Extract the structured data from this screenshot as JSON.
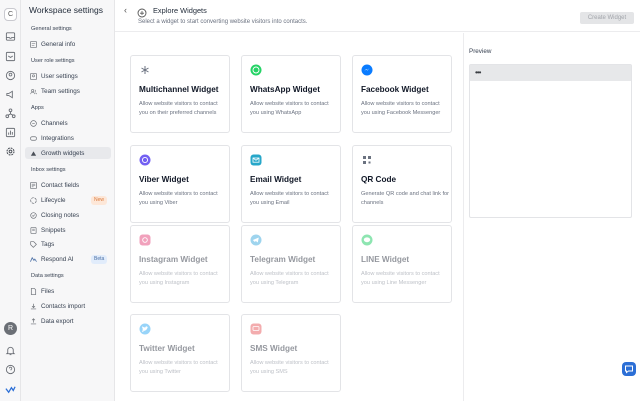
{
  "app": {
    "workspace_initial": "C",
    "user_initial": "R"
  },
  "rail_icons": [
    "inbox-icon",
    "contacts-icon",
    "chat-icon",
    "broadcast-icon",
    "workflow-icon",
    "reports-icon",
    "settings-icon",
    "bell-icon",
    "help-icon",
    "logo-icon"
  ],
  "sidebar": {
    "title": "Workspace settings",
    "sections": {
      "general": "General settings",
      "user_role": "User role settings",
      "apps": "Apps",
      "inbox": "Inbox settings",
      "data": "Data settings"
    },
    "items": {
      "general_info": "General info",
      "user_settings": "User settings",
      "team_settings": "Team settings",
      "channels": "Channels",
      "integrations": "Integrations",
      "growth_widgets": "Growth widgets",
      "contact_fields": "Contact fields",
      "lifecycle": "Lifecycle",
      "closing_notes": "Closing notes",
      "snippets": "Snippets",
      "tags": "Tags",
      "respond_ai": "Respond AI",
      "files": "Files",
      "contacts_import": "Contacts import",
      "data_export": "Data export"
    },
    "badges": {
      "lifecycle": "New",
      "respond_ai": "Beta"
    }
  },
  "header": {
    "back_glyph": "‹",
    "title": "Explore Widgets",
    "subtitle": "Select a widget to start converting website visitors into contacts.",
    "create_button": "Create Widget"
  },
  "widgets": [
    {
      "name": "Multichannel Widget",
      "desc": "Allow website visitors to contact you on their preferred channels",
      "icon": "asterisk-icon",
      "color": "#6b7280",
      "enabled": true
    },
    {
      "name": "WhatsApp Widget",
      "desc": "Allow website visitors to contact you using WhatsApp",
      "icon": "whatsapp-icon",
      "color": "#25d366",
      "enabled": true
    },
    {
      "name": "Facebook Widget",
      "desc": "Allow website visitors to contact you using Facebook Messenger",
      "icon": "messenger-icon",
      "color": "#0a7cff",
      "enabled": true
    },
    {
      "name": "Viber Widget",
      "desc": "Allow website visitors to contact you using Viber",
      "icon": "viber-icon",
      "color": "#7360f2",
      "enabled": true
    },
    {
      "name": "Email Widget",
      "desc": "Allow website visitors to contact you using Email",
      "icon": "email-icon",
      "color": "#27a7c9",
      "enabled": true
    },
    {
      "name": "QR Code",
      "desc": "Generate QR code and chat link for channels",
      "icon": "qr-code-icon",
      "color": "#6b7280",
      "enabled": true
    },
    {
      "name": "Instagram Widget",
      "desc": "Allow website visitors to contact you using Instagram",
      "icon": "instagram-icon",
      "color": "#e1306c",
      "enabled": false
    },
    {
      "name": "Telegram Widget",
      "desc": "Allow website visitors to contact you using Telegram",
      "icon": "telegram-icon",
      "color": "#2aa1da",
      "enabled": false
    },
    {
      "name": "LINE Widget",
      "desc": "Allow website visitors to contact you using Line Messenger",
      "icon": "line-icon",
      "color": "#06c755",
      "enabled": false
    },
    {
      "name": "Twitter Widget",
      "desc": "Allow website visitors to contact you using Twitter",
      "icon": "twitter-icon",
      "color": "#1da1f2",
      "enabled": false
    },
    {
      "name": "SMS Widget",
      "desc": "Allow website visitors to contact you using SMS",
      "icon": "sms-icon",
      "color": "#e5484d",
      "enabled": false
    }
  ],
  "preview": {
    "title": "Preview",
    "dots": "•••"
  },
  "colors": {
    "accent": "#2c6fd6",
    "active_item_bg": "#e8e9ec"
  }
}
